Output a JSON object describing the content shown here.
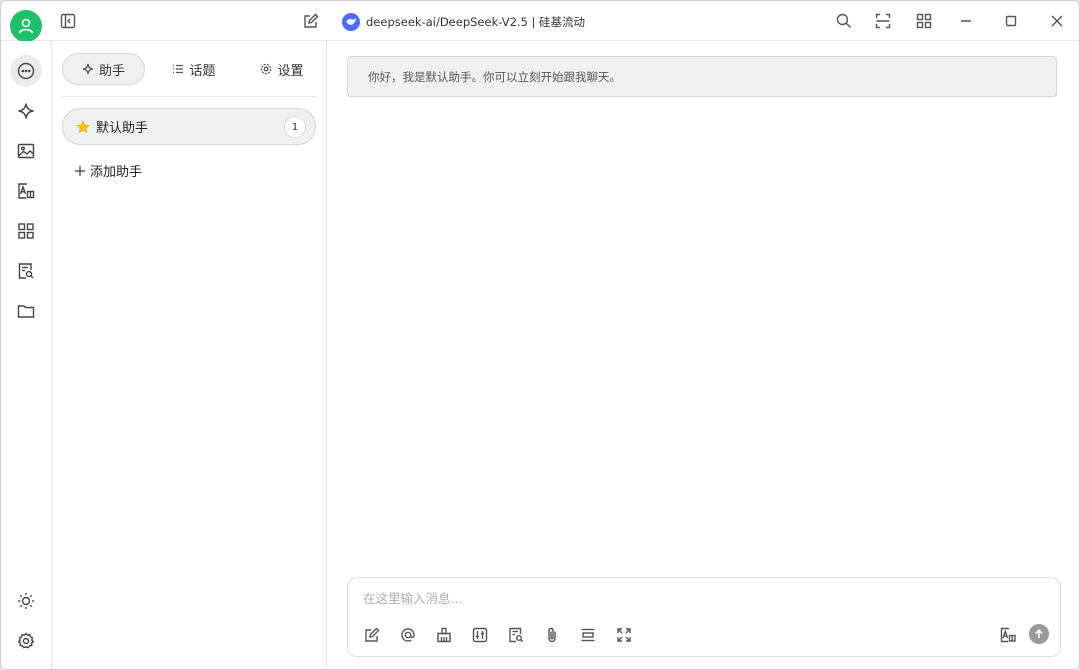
{
  "titlebar": {
    "model_name": "deepseek-ai/DeepSeek-V2.5 | 硅基流动",
    "icons": [
      "sidebar-toggle-icon",
      "edit-icon",
      "search-icon",
      "scan-icon",
      "grid-icon",
      "minimize-icon",
      "maximize-icon",
      "close-icon"
    ]
  },
  "rail": {
    "items": [
      "chat-icon",
      "sparkle-icon",
      "image-icon",
      "translate-icon",
      "apps-icon",
      "document-search-icon",
      "folder-icon"
    ],
    "bottom": [
      "theme-icon",
      "settings-icon"
    ]
  },
  "panel": {
    "tabs": [
      {
        "label": "助手",
        "icon": "sparkle-icon"
      },
      {
        "label": "话题",
        "icon": "list-icon"
      },
      {
        "label": "设置",
        "icon": "gear-icon"
      }
    ],
    "assistant": {
      "label": "默认助手",
      "count": "1"
    },
    "add_label": "添加助手"
  },
  "chat": {
    "greeting": "你好，我是默认助手。你可以立刻开始跟我聊天。",
    "input_placeholder": "在这里输入消息..."
  },
  "colors": {
    "accent_green": "#1fbf6b",
    "model_blue": "#4d6bfe",
    "star_yellow": "#f5c518"
  }
}
